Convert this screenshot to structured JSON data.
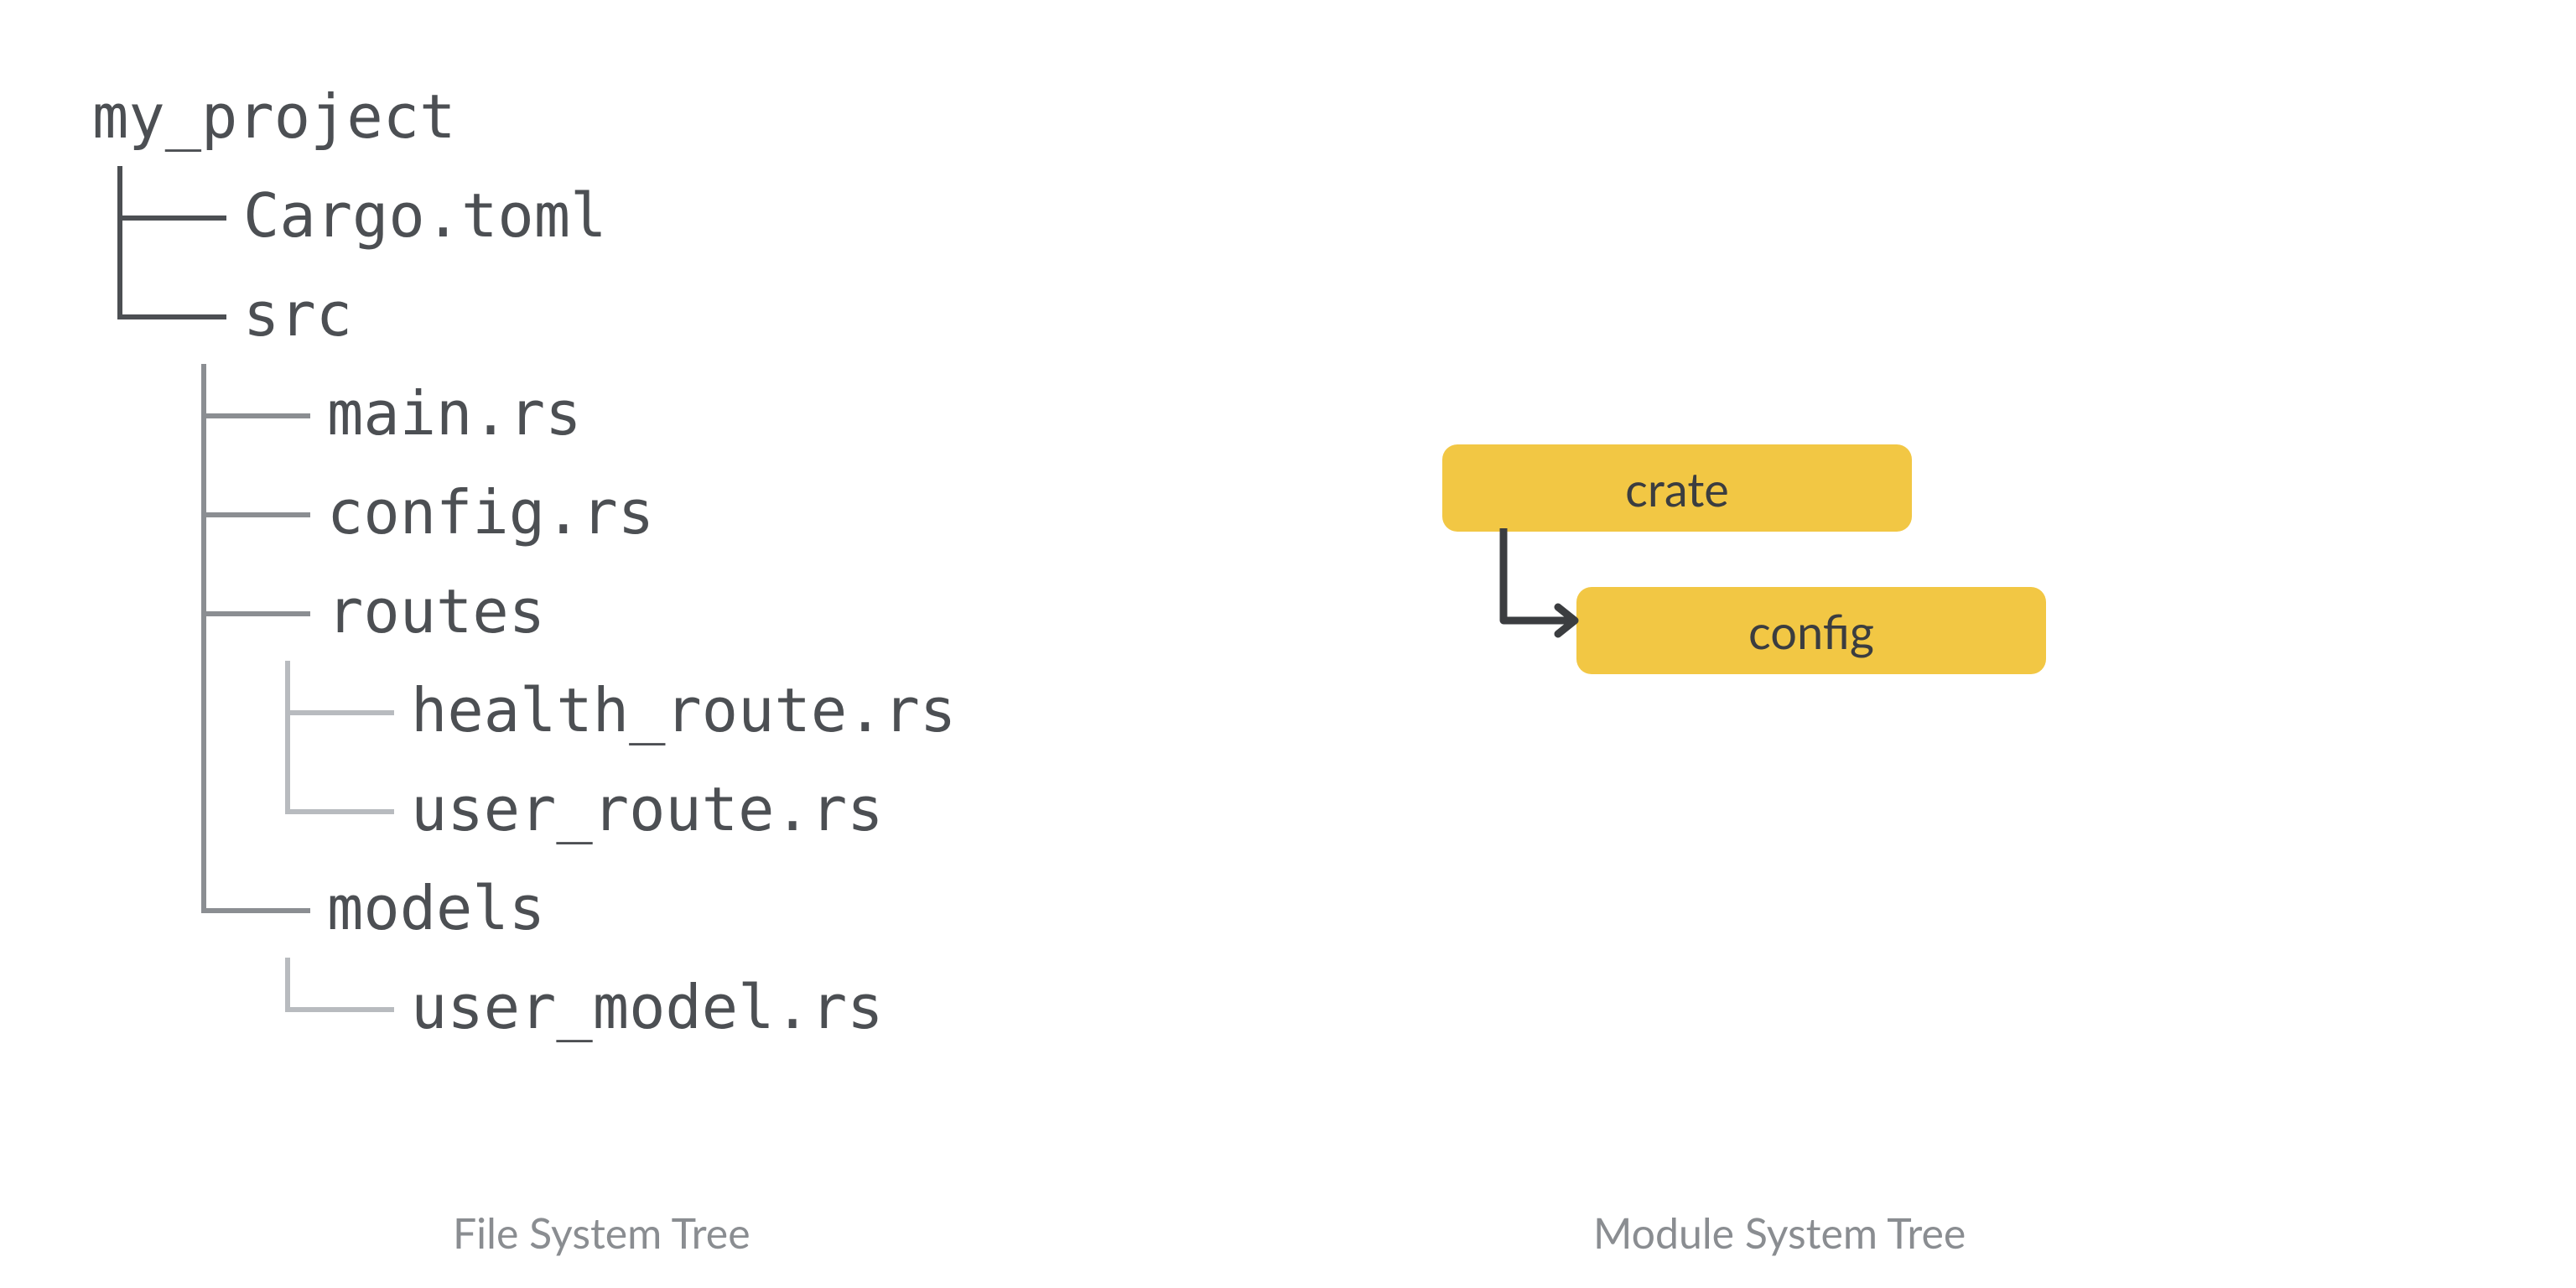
{
  "filetree": {
    "root": "my_project",
    "cargo": "Cargo.toml",
    "src": "src",
    "main": "main.rs",
    "config": "config.rs",
    "routes": "routes",
    "health_route": "health_route.rs",
    "user_route": "user_route.rs",
    "models": "models",
    "user_model": "user_model.rs"
  },
  "modules": {
    "crate": "crate",
    "config": "config"
  },
  "captions": {
    "filetree": "File System Tree",
    "moduletree": "Module System Tree"
  },
  "colors": {
    "box_bg": "#f2c744",
    "text": "#4c4f53",
    "caption": "#8a8d91"
  }
}
